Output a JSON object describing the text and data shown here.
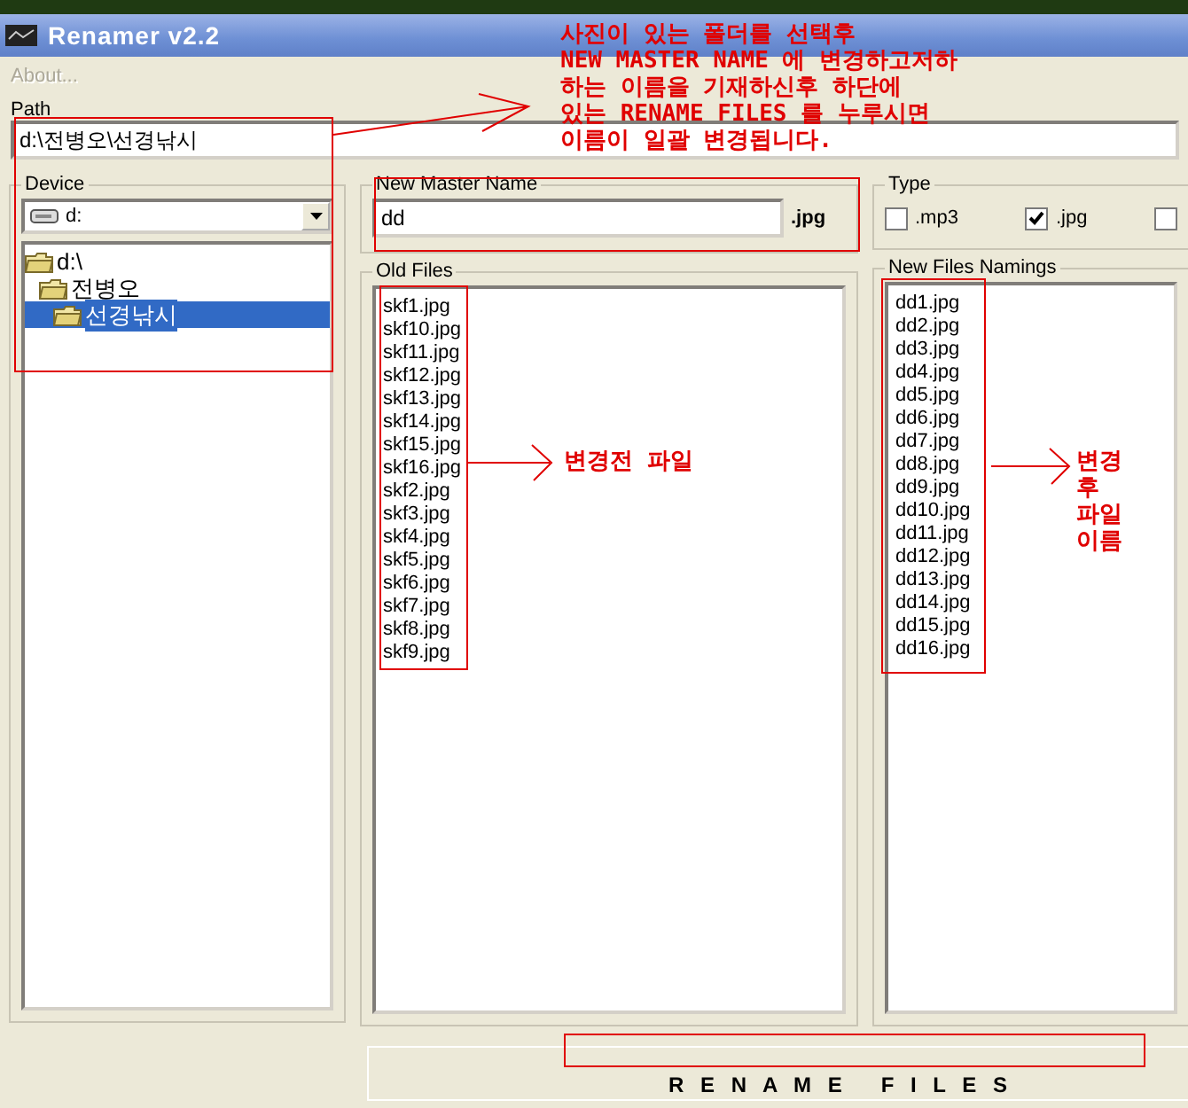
{
  "window": {
    "title": "Renamer v2.2"
  },
  "menu": [
    {
      "label": "About...",
      "disabled": true
    }
  ],
  "path": {
    "label": "Path",
    "value": "d:\\전병오\\선경낚시"
  },
  "device": {
    "label": "Device",
    "drive": "d:",
    "tree": [
      {
        "label": "d:\\",
        "selected": false,
        "children": [
          {
            "label": "전병오",
            "selected": false,
            "children": [
              {
                "label": "선경낚시",
                "selected": true
              }
            ]
          }
        ]
      }
    ]
  },
  "master_name": {
    "label": "New Master Name",
    "value": "dd",
    "extension": ".jpg"
  },
  "type": {
    "label": "Type",
    "options": [
      {
        "label": ".mp3",
        "checked": false
      },
      {
        "label": ".jpg",
        "checked": true
      },
      {
        "checked": false
      }
    ]
  },
  "old_files": {
    "label": "Old Files",
    "items": [
      "skf1.jpg",
      "skf10.jpg",
      "skf11.jpg",
      "skf12.jpg",
      "skf13.jpg",
      "skf14.jpg",
      "skf15.jpg",
      "skf16.jpg",
      "skf2.jpg",
      "skf3.jpg",
      "skf4.jpg",
      "skf5.jpg",
      "skf6.jpg",
      "skf7.jpg",
      "skf8.jpg",
      "skf9.jpg"
    ]
  },
  "new_files": {
    "label": "New Files Namings",
    "items": [
      "dd1.jpg",
      "dd2.jpg",
      "dd3.jpg",
      "dd4.jpg",
      "dd5.jpg",
      "dd6.jpg",
      "dd7.jpg",
      "dd8.jpg",
      "dd9.jpg",
      "dd10.jpg",
      "dd11.jpg",
      "dd12.jpg",
      "dd13.jpg",
      "dd14.jpg",
      "dd15.jpg",
      "dd16.jpg"
    ]
  },
  "rename_button": "R E N A M E   F I L E S",
  "annotations": [
    {
      "lines": [
        "사진이 있는 폴더를 선택후",
        "NEW MASTER NAME 에 변경하고저하",
        "하는 이름을 기재하신후 하단에",
        "있는 RENAME FILES 를 누루시면",
        "이름이 일괄 변경됩니다."
      ]
    },
    {
      "lines": [
        "변경전 파일"
      ]
    },
    {
      "lines": [
        "변경",
        "후",
        "파일",
        "이름"
      ]
    }
  ]
}
